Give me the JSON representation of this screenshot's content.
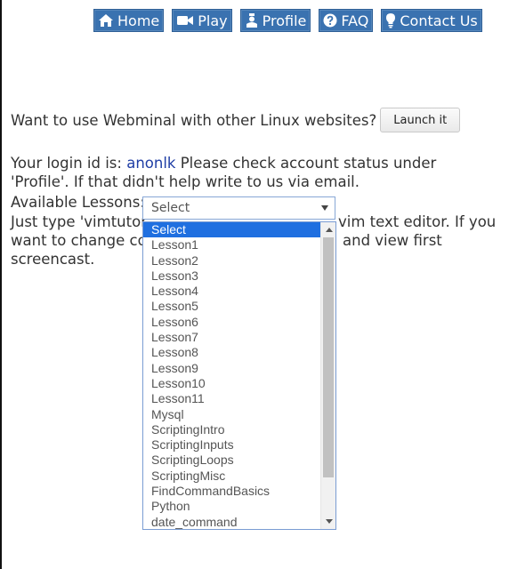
{
  "nav": {
    "items": [
      {
        "label": "Home",
        "icon": "home-icon"
      },
      {
        "label": "Play",
        "icon": "video-camera-icon"
      },
      {
        "label": "Profile",
        "icon": "user-icon"
      },
      {
        "label": "FAQ",
        "icon": "question-circle-icon"
      },
      {
        "label": "Contact Us",
        "icon": "lightbulb-icon"
      }
    ]
  },
  "intro": {
    "question": "Want to use Webminal with other Linux websites?",
    "launch_label": "Launch it"
  },
  "login": {
    "prefix": "Your login id is: ",
    "login_id": "anonlk",
    "suffix": " Please check account status under 'Profile'. If that didn't help write to us via email."
  },
  "lessons": {
    "label": "Available Lessons:",
    "selected": "Select",
    "options": [
      "Select",
      "Lesson1",
      "Lesson2",
      "Lesson3",
      "Lesson4",
      "Lesson5",
      "Lesson6",
      "Lesson7",
      "Lesson8",
      "Lesson9",
      "Lesson10",
      "Lesson11",
      "Mysql",
      "ScriptingIntro",
      "ScriptingInputs",
      "ScriptingLoops",
      "ScriptingMisc",
      "FindCommandBasics",
      "Python",
      "date_command"
    ]
  },
  "instructions": {
    "line1_start": "Just type 'vimtutor",
    "line1_end": "vim text editor. If you",
    "line2_start": "want to change col",
    "line2_end": "and view first",
    "line3": "screencast."
  },
  "colors": {
    "nav_bg": "#3a72b0",
    "link": "#1f3ea5",
    "selected_option": "#1f6fe0"
  }
}
